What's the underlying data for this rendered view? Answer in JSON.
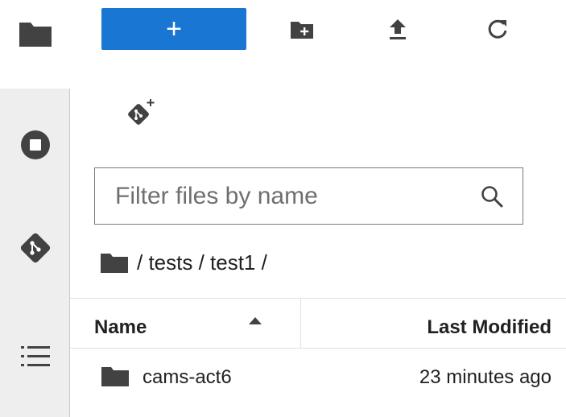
{
  "toolbar": {
    "new_label": "+",
    "icons": [
      "folder-icon",
      "new-folder-icon",
      "upload-icon",
      "refresh-icon"
    ]
  },
  "sidebar": {
    "icons": [
      "stop-circle-icon",
      "git-icon",
      "list-icon"
    ]
  },
  "git_clone_icon": "git-plus-icon",
  "search": {
    "placeholder": "Filter files by name",
    "value": ""
  },
  "breadcrumb": {
    "path": "/ tests / test1 /"
  },
  "file_table": {
    "columns": [
      "Name",
      "Last Modified"
    ],
    "sort": "ascending",
    "rows": [
      {
        "name": "cams-act6",
        "type": "folder",
        "modified": "23 minutes ago"
      }
    ]
  },
  "colors": {
    "accent": "#1976d2",
    "sidebar_bg": "#eeeeee",
    "icon": "#424242"
  }
}
